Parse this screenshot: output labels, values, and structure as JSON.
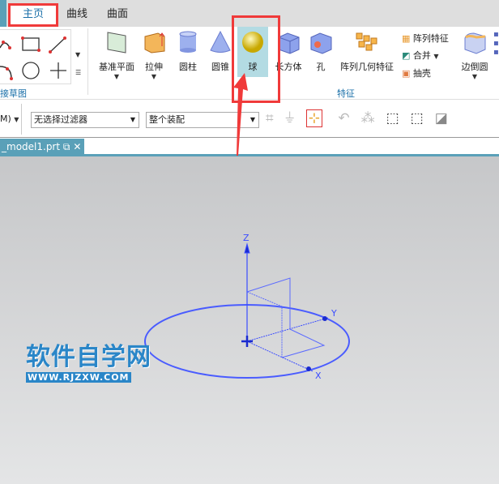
{
  "ribbon_tabs": [
    "主页",
    "曲线",
    "曲面"
  ],
  "sketch_group_label": "接草图",
  "features": {
    "datum_plane": "基准平面",
    "extrude": "拉伸",
    "cylinder": "圆柱",
    "cone": "圆锥",
    "sphere": "球",
    "block": "长方体",
    "hole": "孔",
    "pattern_geometry": "阵列几何特征",
    "pattern_feature": "阵列特征",
    "unite": "合并",
    "shell": "抽壳",
    "edge_blend": "边倒圆",
    "group_label": "特征"
  },
  "toolbar": {
    "menu_fragment": "M)",
    "filter": "无选择过滤器",
    "scope": "整个装配"
  },
  "document_tab": "_model1.prt",
  "viewport": {
    "axes": {
      "x": "X",
      "y": "Y",
      "z": "Z"
    }
  },
  "watermark": {
    "title": "软件自学网",
    "url": "WWW.RJZXW.COM"
  },
  "colors": {
    "accent": "#1a6fa8",
    "wire": "#3a4cff",
    "highlight": "#f03a3a"
  }
}
